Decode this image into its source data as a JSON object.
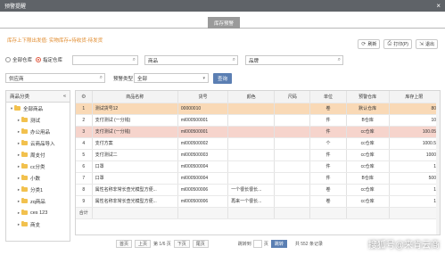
{
  "window": {
    "title": "预警提醒",
    "close": "×"
  },
  "tabs": [
    {
      "label": "库存预警",
      "active": true
    }
  ],
  "rule_text": "库存上下限出发值: 实物库存+待收货-待发货",
  "toolbar": {
    "refresh": "刷新",
    "print": "打印(P)",
    "exit": "退出"
  },
  "filters": {
    "radio_all": "全部仓库",
    "radio_specified": "指定仓库",
    "goods_placeholder": "商品",
    "brand_placeholder": "品牌",
    "supplier_placeholder": "供应商",
    "warning_type_label": "预警类型",
    "warning_type_value": "全部",
    "query": "查询"
  },
  "tree": {
    "title": "商品分类",
    "collapse_icon": "«",
    "items": [
      {
        "label": "全部商品",
        "level": 0,
        "expanded": true
      },
      {
        "label": "测试",
        "level": 1
      },
      {
        "label": "办公用品",
        "level": 1
      },
      {
        "label": "云商品导入",
        "level": 1
      },
      {
        "label": "周支付",
        "level": 1
      },
      {
        "label": "cc分类",
        "level": 1
      },
      {
        "label": "小数",
        "level": 1
      },
      {
        "label": "分类1",
        "level": 1
      },
      {
        "label": "zq商品",
        "level": 1
      },
      {
        "label": "ces 123",
        "level": 1
      },
      {
        "label": "商支",
        "level": 1
      }
    ]
  },
  "table": {
    "columns": [
      "",
      "商品名称",
      "货号",
      "颜色",
      "尺码",
      "单位",
      "预警仓库",
      "库存上限"
    ],
    "rows": [
      {
        "no": "1",
        "name": "测试货号12",
        "code": "00000010",
        "color": "",
        "size": "",
        "unit": "卷",
        "warehouse": "默认仓库",
        "limit": "80",
        "hl": "hl1"
      },
      {
        "no": "2",
        "name": "支付测试 (一分钱)",
        "code": "ml000500001",
        "color": "",
        "size": "",
        "unit": "件",
        "warehouse": "B仓库",
        "limit": "10",
        "hl": ""
      },
      {
        "no": "3",
        "name": "支付测试 (一分钱)",
        "code": "ml000500001",
        "color": "",
        "size": "",
        "unit": "件",
        "warehouse": "cc仓库",
        "limit": "100.05",
        "hl": "hl2"
      },
      {
        "no": "4",
        "name": "支付方案",
        "code": "ml000500002",
        "color": "",
        "size": "",
        "unit": "个",
        "warehouse": "cc仓库",
        "limit": "1000.5",
        "hl": ""
      },
      {
        "no": "5",
        "name": "支付测试二",
        "code": "ml000500003",
        "color": "",
        "size": "",
        "unit": "件",
        "warehouse": "cc仓库",
        "limit": "1000",
        "hl": ""
      },
      {
        "no": "6",
        "name": "口罩",
        "code": "ml000500004",
        "color": "",
        "size": "",
        "unit": "件",
        "warehouse": "cc仓库",
        "limit": "1",
        "hl": ""
      },
      {
        "no": "7",
        "name": "口罩",
        "code": "ml000500004",
        "color": "",
        "size": "",
        "unit": "件",
        "warehouse": "B仓库",
        "limit": "500",
        "hl": ""
      },
      {
        "no": "8",
        "name": "属性名称非常长查光模型方便...",
        "code": "ml000500006",
        "color": "一个很长很长...",
        "size": "",
        "unit": "卷",
        "warehouse": "cc仓库",
        "limit": "1",
        "hl": ""
      },
      {
        "no": "9",
        "name": "属性名称非常长查光模型方便...",
        "code": "ml000500006",
        "color": "再来一个很长...",
        "size": "",
        "unit": "卷",
        "warehouse": "cc仓库",
        "limit": "1",
        "hl": ""
      }
    ],
    "total_label": "合计"
  },
  "pager": {
    "first": "首页",
    "prev": "上页",
    "page_info": "第 1/6 页",
    "next": "下页",
    "last": "尾页",
    "jump_to": "跳转到",
    "page_suffix": "页",
    "go": "跳转",
    "total": "共 552 条记录"
  },
  "watermark": "搜狐号@来肯云商"
}
